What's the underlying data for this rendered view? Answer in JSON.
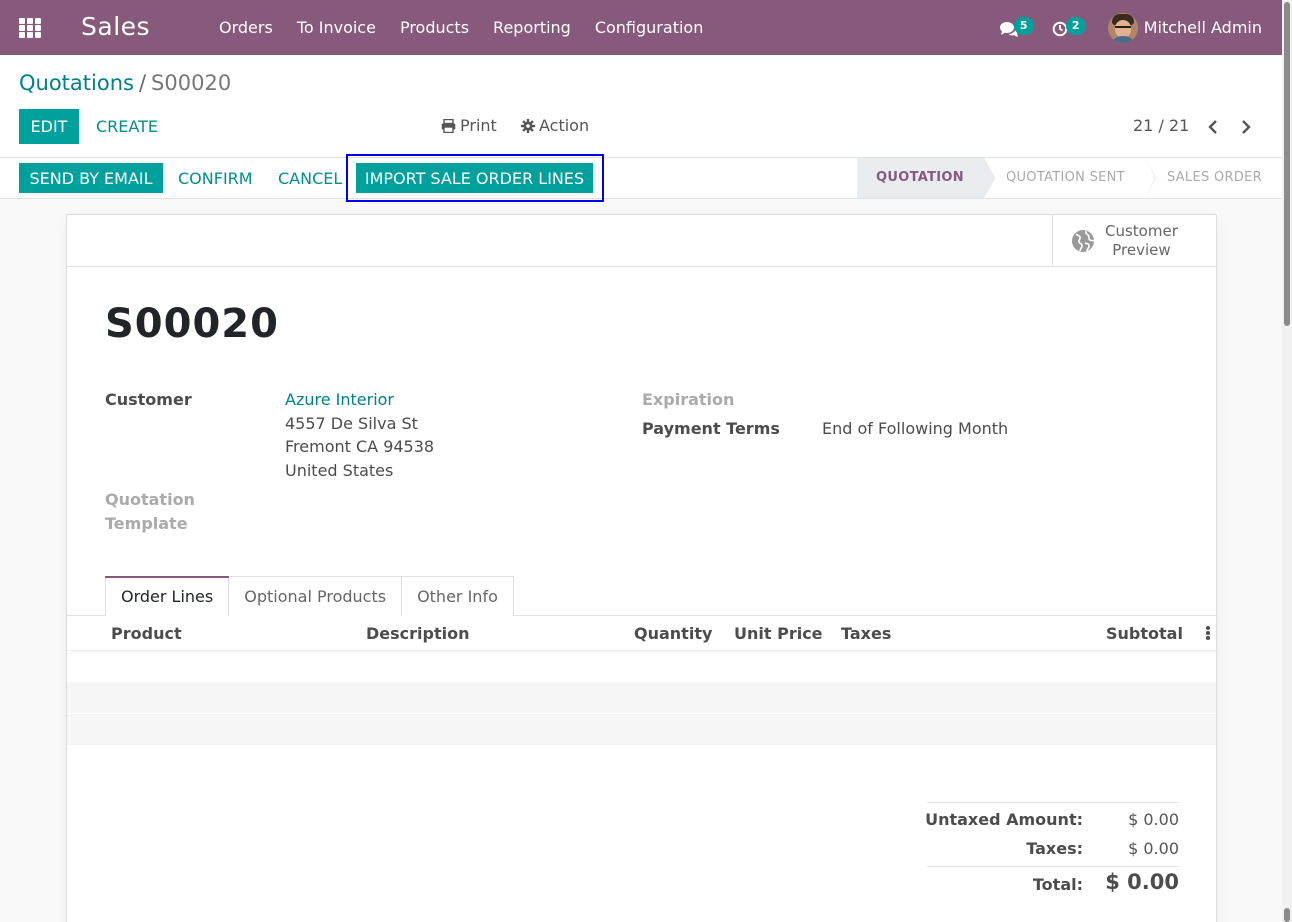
{
  "navbar": {
    "app_name": "Sales",
    "menu": [
      "Orders",
      "To Invoice",
      "Products",
      "Reporting",
      "Configuration"
    ],
    "messages_count": "5",
    "activities_count": "2",
    "user_name": "Mitchell Admin"
  },
  "control_panel": {
    "breadcrumb_parent": "Quotations",
    "breadcrumb_separator": "/",
    "breadcrumb_current": "S00020",
    "edit_label": "EDIT",
    "create_label": "CREATE",
    "print_label": "Print",
    "action_label": "Action",
    "pager": "21 / 21"
  },
  "statusbar": {
    "buttons": {
      "send_email": "SEND BY EMAIL",
      "confirm": "CONFIRM",
      "cancel": "CANCEL",
      "import_lines": "IMPORT SALE ORDER LINES"
    },
    "stages": [
      "QUOTATION",
      "QUOTATION SENT",
      "SALES ORDER"
    ],
    "active_stage": "QUOTATION"
  },
  "form": {
    "customer_preview_line1": "Customer",
    "customer_preview_line2": "Preview",
    "record_name": "S00020",
    "customer_label": "Customer",
    "customer_name": "Azure Interior",
    "address_line1": "4557 De Silva St",
    "address_line2": "Fremont CA 94538",
    "address_line3": "United States",
    "template_label_line1": "Quotation",
    "template_label_line2": "Template",
    "expiration_label": "Expiration",
    "payment_terms_label": "Payment Terms",
    "payment_terms_value": "End of Following Month"
  },
  "tabs": [
    "Order Lines",
    "Optional Products",
    "Other Info"
  ],
  "active_tab": "Order Lines",
  "table": {
    "columns": [
      "Product",
      "Description",
      "Quantity",
      "Unit Price",
      "Taxes",
      "Subtotal"
    ]
  },
  "totals": {
    "untaxed_label": "Untaxed Amount:",
    "untaxed_value": "$ 0.00",
    "taxes_label": "Taxes:",
    "taxes_value": "$ 0.00",
    "total_label": "Total:",
    "total_value": "$ 0.00"
  },
  "colors": {
    "brand": "#875a7b",
    "primary": "#00a09d",
    "link": "#00818a",
    "highlight": "#0000ee"
  },
  "icons": {
    "apps": "apps-grid-icon",
    "messages": "chat-bubbles-icon",
    "activities": "clock-icon",
    "print": "printer-icon",
    "action": "gear-icon",
    "prev": "chevron-left-icon",
    "next": "chevron-right-icon",
    "preview": "globe-icon",
    "optional_columns": "vertical-ellipsis-icon"
  }
}
